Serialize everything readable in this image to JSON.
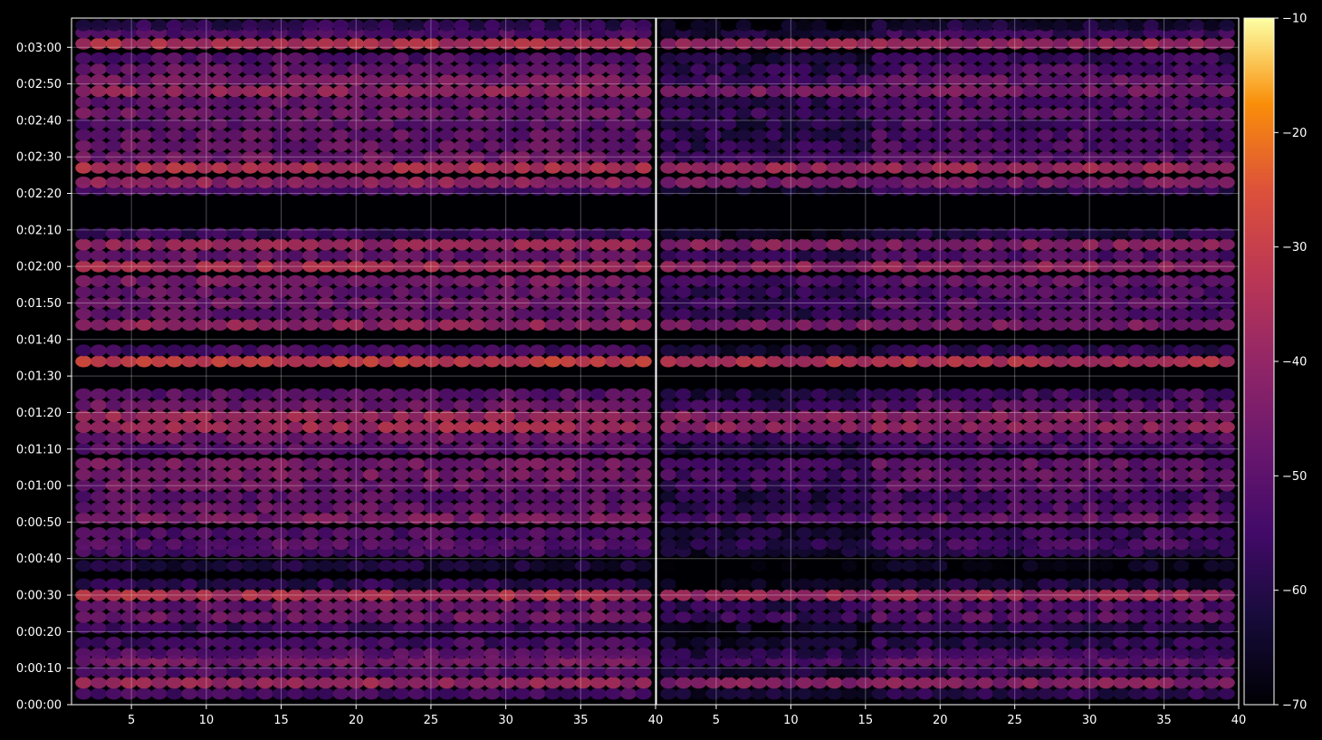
{
  "chart_data": {
    "type": "heatmap",
    "title": "",
    "xlabel": "",
    "ylabel": "",
    "panels": 2,
    "x_range": [
      1,
      40
    ],
    "x_ticks": [
      5,
      10,
      15,
      20,
      25,
      30,
      35,
      40
    ],
    "y_range_seconds": [
      0,
      188
    ],
    "y_tick_labels": [
      "0:00:00",
      "0:00:10",
      "0:00:20",
      "0:00:30",
      "0:00:40",
      "0:00:50",
      "0:01:00",
      "0:01:10",
      "0:01:20",
      "0:01:30",
      "0:01:40",
      "0:01:50",
      "0:02:00",
      "0:02:10",
      "0:02:20",
      "0:02:30",
      "0:02:40",
      "0:02:50",
      "0:03:00"
    ],
    "colorbar": {
      "min": -70,
      "max": -10,
      "ticks": [
        "−10",
        "−20",
        "−30",
        "−40",
        "−50",
        "−60",
        "−70"
      ],
      "colormap": "inferno"
    },
    "grid": true,
    "row_profile": [
      {
        "t": 3,
        "v": -54
      },
      {
        "t": 6,
        "v": -38
      },
      {
        "t": 9,
        "v": -52
      },
      {
        "t": 12,
        "v": -44
      },
      {
        "t": 14,
        "v": -50
      },
      {
        "t": 17,
        "v": -54
      },
      {
        "t": 21,
        "v": -56
      },
      {
        "t": 24,
        "v": -46
      },
      {
        "t": 27,
        "v": -48
      },
      {
        "t": 30,
        "v": -34
      },
      {
        "t": 33,
        "v": -58
      },
      {
        "t": 38,
        "v": -62
      },
      {
        "t": 42,
        "v": -54
      },
      {
        "t": 44,
        "v": -50
      },
      {
        "t": 47,
        "v": -52
      },
      {
        "t": 51,
        "v": -44
      },
      {
        "t": 54,
        "v": -48
      },
      {
        "t": 57,
        "v": -50
      },
      {
        "t": 60,
        "v": -46
      },
      {
        "t": 63,
        "v": -44
      },
      {
        "t": 66,
        "v": -44
      },
      {
        "t": 70,
        "v": -50
      },
      {
        "t": 73,
        "v": -46
      },
      {
        "t": 76,
        "v": -36
      },
      {
        "t": 79,
        "v": -38
      },
      {
        "t": 82,
        "v": -46
      },
      {
        "t": 85,
        "v": -50
      },
      {
        "t": 94,
        "v": -30
      },
      {
        "t": 97,
        "v": -54
      },
      {
        "t": 104,
        "v": -40
      },
      {
        "t": 107,
        "v": -48
      },
      {
        "t": 110,
        "v": -46
      },
      {
        "t": 113,
        "v": -48
      },
      {
        "t": 116,
        "v": -44
      },
      {
        "t": 120,
        "v": -36
      },
      {
        "t": 123,
        "v": -48
      },
      {
        "t": 126,
        "v": -38
      },
      {
        "t": 129,
        "v": -56
      },
      {
        "t": 141,
        "v": -54
      },
      {
        "t": 143,
        "v": -40
      },
      {
        "t": 147,
        "v": -34
      },
      {
        "t": 150,
        "v": -46
      },
      {
        "t": 153,
        "v": -48
      },
      {
        "t": 156,
        "v": -48
      },
      {
        "t": 159,
        "v": -50
      },
      {
        "t": 162,
        "v": -46
      },
      {
        "t": 165,
        "v": -48
      },
      {
        "t": 168,
        "v": -40
      },
      {
        "t": 171,
        "v": -44
      },
      {
        "t": 174,
        "v": -48
      },
      {
        "t": 177,
        "v": -52
      },
      {
        "t": 181,
        "v": -34
      },
      {
        "t": 184,
        "v": -52
      },
      {
        "t": 186,
        "v": -58
      }
    ]
  }
}
